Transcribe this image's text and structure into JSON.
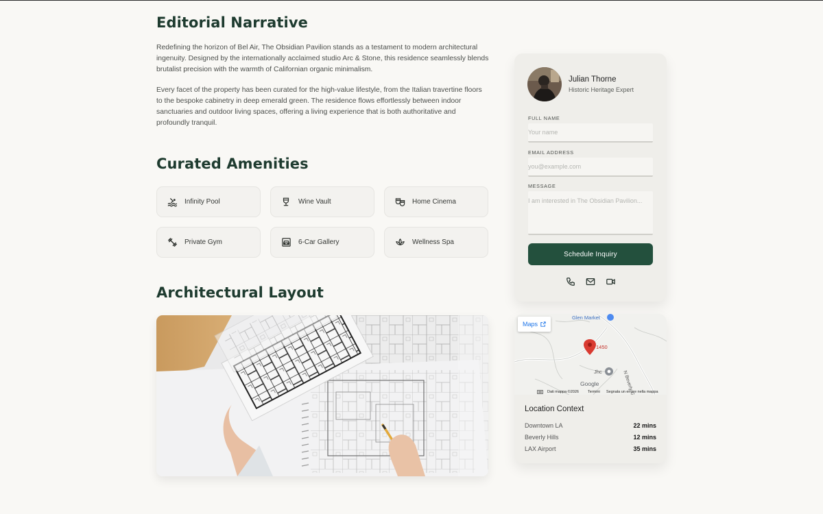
{
  "narrative": {
    "title": "Editorial Narrative",
    "paragraphs": [
      "Redefining the horizon of Bel Air, The Obsidian Pavilion stands as a testament to modern architectural ingenuity. Designed by the internationally acclaimed studio Arc & Stone, this residence seamlessly blends brutalist precision with the warmth of Californian organic minimalism.",
      "Every facet of the property has been curated for the high-value lifestyle, from the Italian travertine floors to the bespoke cabinetry in deep emerald green. The residence flows effortlessly between indoor sanctuaries and outdoor living spaces, offering a living experience that is both authoritative and profoundly tranquil."
    ]
  },
  "amenities": {
    "title": "Curated Amenities",
    "items": [
      {
        "label": "Infinity Pool",
        "icon": "pool-icon"
      },
      {
        "label": "Wine Vault",
        "icon": "wine-glass-icon"
      },
      {
        "label": "Home Cinema",
        "icon": "theater-masks-icon"
      },
      {
        "label": "Private Gym",
        "icon": "dumbbell-icon"
      },
      {
        "label": "6-Car Gallery",
        "icon": "garage-icon"
      },
      {
        "label": "Wellness Spa",
        "icon": "spa-lotus-icon"
      }
    ]
  },
  "layout": {
    "title": "Architectural Layout",
    "image": "architectural-blueprint-photo"
  },
  "agent": {
    "name": "Julian Thorne",
    "role": "Historic Heritage Expert"
  },
  "form": {
    "name_label": "FULL NAME",
    "name_placeholder": "Your name",
    "email_label": "EMAIL ADDRESS",
    "email_placeholder": "you@example.com",
    "message_label": "MESSAGE",
    "message_placeholder": "I am interested in The Obsidian Pavilion...",
    "submit_label": "Schedule Inquiry"
  },
  "contact_icons": [
    "phone-icon",
    "mail-icon",
    "video-icon"
  ],
  "map": {
    "maps_button": "Maps",
    "place_label": "Glen Market",
    "pin_label": "1450",
    "poi_label": "Jhc",
    "street_label": "N Beverly G",
    "brand": "Google",
    "attribution": "Dati mappa ©2026",
    "terms": "Termini",
    "report": "Segnala un errore nella mappa"
  },
  "location": {
    "title": "Location Context",
    "rows": [
      {
        "place": "Downtown LA",
        "time": "22 mins"
      },
      {
        "place": "Beverly Hills",
        "time": "12 mins"
      },
      {
        "place": "LAX Airport",
        "time": "35 mins"
      }
    ]
  },
  "colors": {
    "accent": "#23503d",
    "heading": "#1e3b2f",
    "background": "#f9f8f5",
    "card": "#efeeea",
    "map_pin": "#d93a30"
  }
}
